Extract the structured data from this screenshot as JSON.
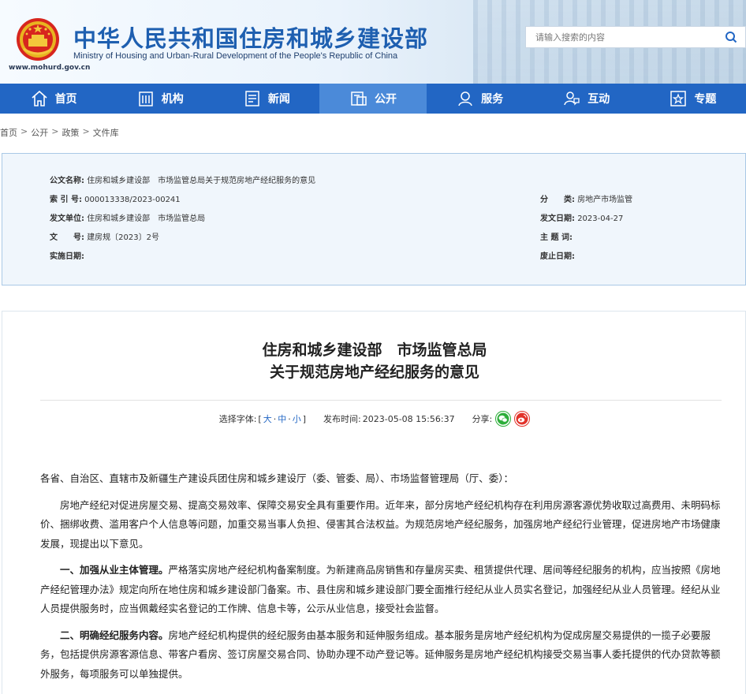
{
  "header": {
    "title": "中华人民共和国住房和城乡建设部",
    "subtitle": "Ministry of Housing and Urban-Rural Development of the People's Republic of China",
    "url": "www.mohurd.gov.cn",
    "search_placeholder": "请输入搜索的内容"
  },
  "nav": {
    "items": [
      {
        "label": "首页",
        "icon": "home-icon"
      },
      {
        "label": "机构",
        "icon": "building-icon"
      },
      {
        "label": "新闻",
        "icon": "news-icon"
      },
      {
        "label": "公开",
        "icon": "disclosure-icon",
        "active": true
      },
      {
        "label": "服务",
        "icon": "service-icon"
      },
      {
        "label": "互动",
        "icon": "interact-icon"
      },
      {
        "label": "专题",
        "icon": "topic-icon"
      }
    ]
  },
  "breadcrumb": [
    "首页",
    "公开",
    "政策",
    "文件库"
  ],
  "meta": {
    "doc_name_label": "公文名称:",
    "doc_name": "住房和城乡建设部　市场监管总局关于规范房地产经纪服务的意见",
    "index_label": "索 引 号:",
    "index": "000013338/2023-00241",
    "category_label": "分　　类:",
    "category": "房地产市场监管",
    "issuer_label": "发文单位:",
    "issuer": "住房和城乡建设部　市场监管总局",
    "issue_date_label": "发文日期:",
    "issue_date": "2023-04-27",
    "doc_no_label": "文　　号:",
    "doc_no": "建房规〔2023〕2号",
    "keywords_label": "主 题 词:",
    "keywords": "",
    "effective_label": "实施日期:",
    "effective": "",
    "repeal_label": "废止日期:",
    "repeal": ""
  },
  "article": {
    "title_line1": "住房和城乡建设部　市场监管总局",
    "title_line2": "关于规范房地产经纪服务的意见",
    "font_label": "选择字体:",
    "font_open": "[",
    "font_large": "大",
    "font_medium": "中",
    "font_small": "小",
    "font_close": "]",
    "font_dot": "·",
    "publish_label": "发布时间:",
    "publish_time": "2023-05-08 15:56:37",
    "share_label": "分享:",
    "salutation": "各省、自治区、直辖市及新疆生产建设兵团住房和城乡建设厅（委、管委、局）、市场监督管理局（厅、委）：",
    "intro": "房地产经纪对促进房屋交易、提高交易效率、保障交易安全具有重要作用。近年来，部分房地产经纪机构存在利用房源客源优势收取过高费用、未明码标价、捆绑收费、滥用客户个人信息等问题，加重交易当事人负担、侵害其合法权益。为规范房地产经纪服务，加强房地产经纪行业管理，促进房地产市场健康发展，现提出以下意见。",
    "s1_head": "一、加强从业主体管理。",
    "s1_body": "严格落实房地产经纪机构备案制度。为新建商品房销售和存量房买卖、租赁提供代理、居间等经纪服务的机构，应当按照《房地产经纪管理办法》规定向所在地住房和城乡建设部门备案。市、县住房和城乡建设部门要全面推行经纪从业人员实名登记，加强经纪从业人员管理。经纪从业人员提供服务时，应当佩戴经实名登记的工作牌、信息卡等，公示从业信息，接受社会监督。",
    "s2_head": "二、明确经纪服务内容。",
    "s2_body": "房地产经纪机构提供的经纪服务由基本服务和延伸服务组成。基本服务是房地产经纪机构为促成房屋交易提供的一揽子必要服务，包括提供房源客源信息、带客户看房、签订房屋交易合同、协助办理不动产登记等。延伸服务是房地产经纪机构接受交易当事人委托提供的代办贷款等额外服务，每项服务可以单独提供。"
  },
  "colors": {
    "nav_bg": "#2266c4",
    "nav_active": "#4b8ad9",
    "title_blue": "#1e5fb0",
    "meta_bg": "#f0f6fc"
  }
}
